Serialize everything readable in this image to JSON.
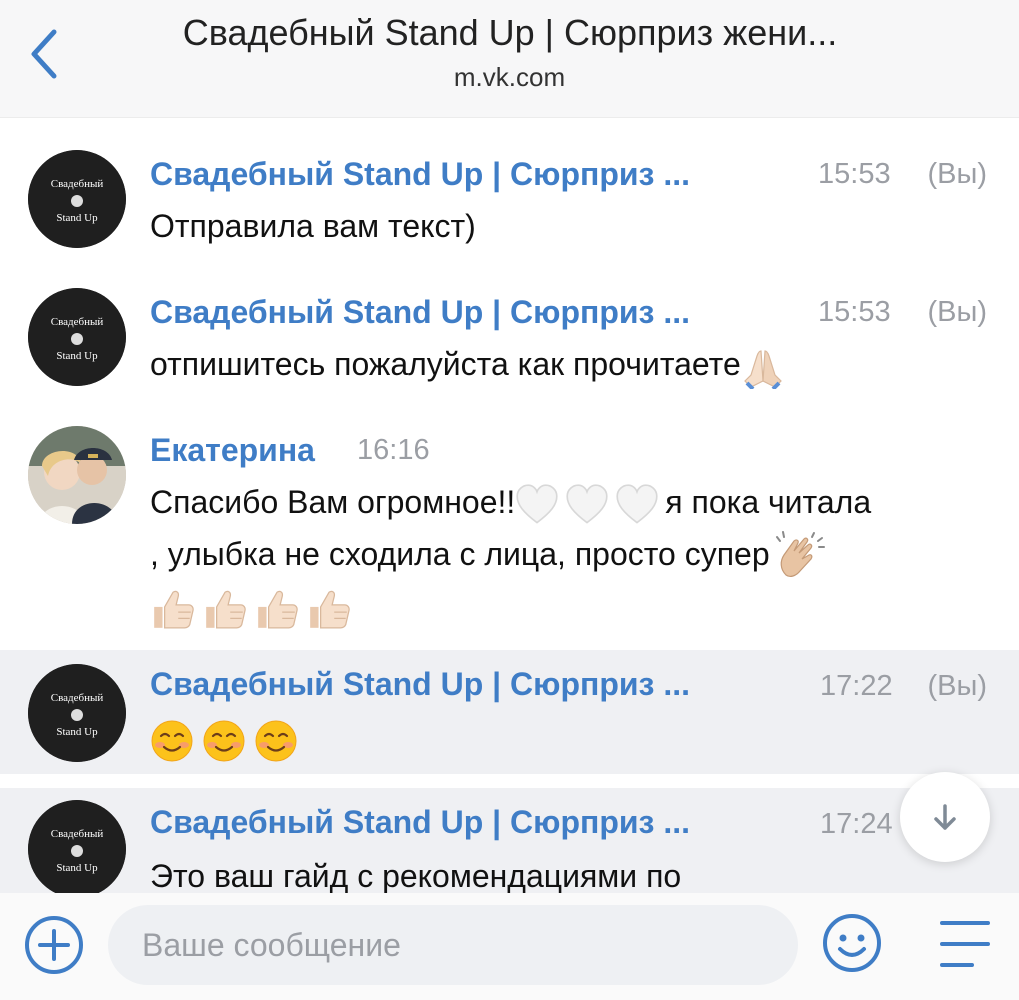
{
  "header": {
    "title": "Свадебный Stand Up | Сюрприз жени...",
    "subtitle": "m.vk.com",
    "back_icon": "chevron-left-icon"
  },
  "avatar_text": {
    "line1": "Свадебный",
    "line2": "Stand Up"
  },
  "messages": [
    {
      "sender": "Свадебный Stand Up | Сюрприз ...",
      "time": "15:53",
      "you": "(Вы)",
      "text": "Отправила вам текст)"
    },
    {
      "sender": "Свадебный Stand Up | Сюрприз ...",
      "time": "15:53",
      "you": "(Вы)",
      "text": "отпишитесь пожалуйста как прочитаете",
      "emoji": "praying-hands"
    },
    {
      "sender": "Екатерина",
      "time": "16:16",
      "text_line1_start": "Спасибо Вам огромное!!",
      "text_line1_end": "я пока читала",
      "text_line2": ", улыбка не сходила с лица, просто супер",
      "emoji": [
        "white-heart",
        "white-heart",
        "white-heart",
        "clapping-hands",
        "thumbs-up",
        "thumbs-up",
        "thumbs-up",
        "thumbs-up"
      ]
    },
    {
      "sender": "Свадебный Stand Up | Сюрприз ...",
      "time": "17:22",
      "you": "(Вы)",
      "emoji": [
        "smiling-face",
        "smiling-face",
        "smiling-face"
      ]
    },
    {
      "sender": "Свадебный Stand Up | Сюрприз ...",
      "time": "17:24",
      "text": "Это ваш гайд с рекомендациями по"
    }
  ],
  "scroll_down_icon": "arrow-down-icon",
  "composer": {
    "placeholder": "Ваше сообщение",
    "value": "",
    "add_icon": "plus-circle-icon",
    "emoji_icon": "smiley-icon",
    "menu_icon": "menu-icon"
  },
  "colors": {
    "accent": "#3f7dc6",
    "time": "#9b9ea4",
    "highlight": "#eff0f3"
  }
}
